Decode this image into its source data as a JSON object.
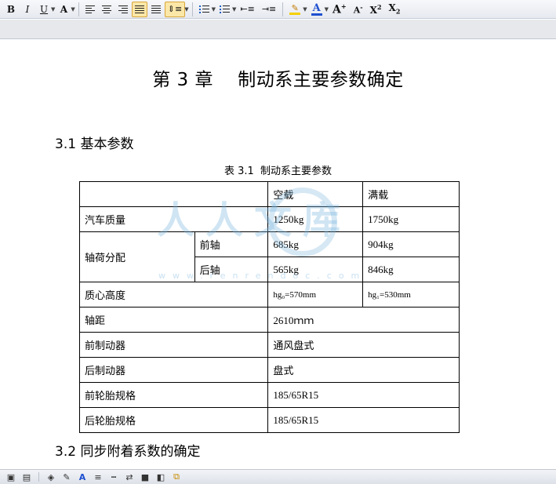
{
  "toolbar": {
    "bold": "B",
    "italic": "I",
    "underline": "U",
    "font_color_a": "A",
    "grow_font": "A",
    "shrink_font": "A",
    "superscript_label": "X",
    "superscript_mark": "2",
    "subscript_label": "X",
    "subscript_mark": "2",
    "icons": [
      "bold-icon",
      "italic-icon",
      "underline-icon",
      "text-effect-icon",
      "align-left-icon",
      "align-center-icon",
      "align-right-icon",
      "justify-icon",
      "distributed-icon",
      "line-spacing-icon",
      "numbered-list-icon",
      "bullet-list-icon",
      "decrease-indent-icon",
      "increase-indent-icon",
      "highlight-icon",
      "font-color-icon",
      "grow-font-icon",
      "shrink-font-icon",
      "superscript-icon",
      "subscript-icon"
    ]
  },
  "document": {
    "chapter_title": "第 3 章    制动系主要参数确定",
    "section1_heading": "3.1 基本参数",
    "table_caption": "表 3.1  制动系主要参数",
    "section2_heading": "3.2 同步附着系数的确定"
  },
  "table": {
    "header": {
      "empty": "",
      "empty_load": "空载",
      "full_load": "满载"
    },
    "vehicle_mass": {
      "label": "汽车质量",
      "empty": "1250kg",
      "full": "1750kg"
    },
    "axle_load": {
      "label": "轴荷分配",
      "front": {
        "label": "前轴",
        "empty": "685kg",
        "full": "904kg"
      },
      "rear": {
        "label": "后轴",
        "empty": "565kg",
        "full": "846kg"
      }
    },
    "cg_height": {
      "label": "质心高度",
      "empty": "hg₀=570mm",
      "full": "hg₁=530mm"
    },
    "wheelbase": {
      "label": "轴距",
      "value": "2610ｍｍ"
    },
    "front_brake": {
      "label": "前制动器",
      "value": "通风盘式"
    },
    "rear_brake": {
      "label": "后制动器",
      "value": "盘式"
    },
    "front_tire": {
      "label": "前轮胎规格",
      "value": "185/65R15"
    },
    "rear_tire": {
      "label": "后轮胎规格",
      "value": "185/65R15"
    }
  },
  "watermark": {
    "text": "人人文库",
    "url": "www.renrendoc.com"
  },
  "bottom_toolbar": {
    "icons": [
      "draw-icon",
      "textbox-icon",
      "fill-icon",
      "line-color-icon",
      "font-color-icon",
      "line-style-icon",
      "dash-style-icon",
      "arrow-style-icon",
      "shadow-icon",
      "3d-icon",
      "arrange-icon"
    ]
  },
  "colors": {
    "highlight_active": "#fbe7a8",
    "font_color_blue": "#1d4fd0",
    "highlight_yellow": "#f4d000"
  }
}
